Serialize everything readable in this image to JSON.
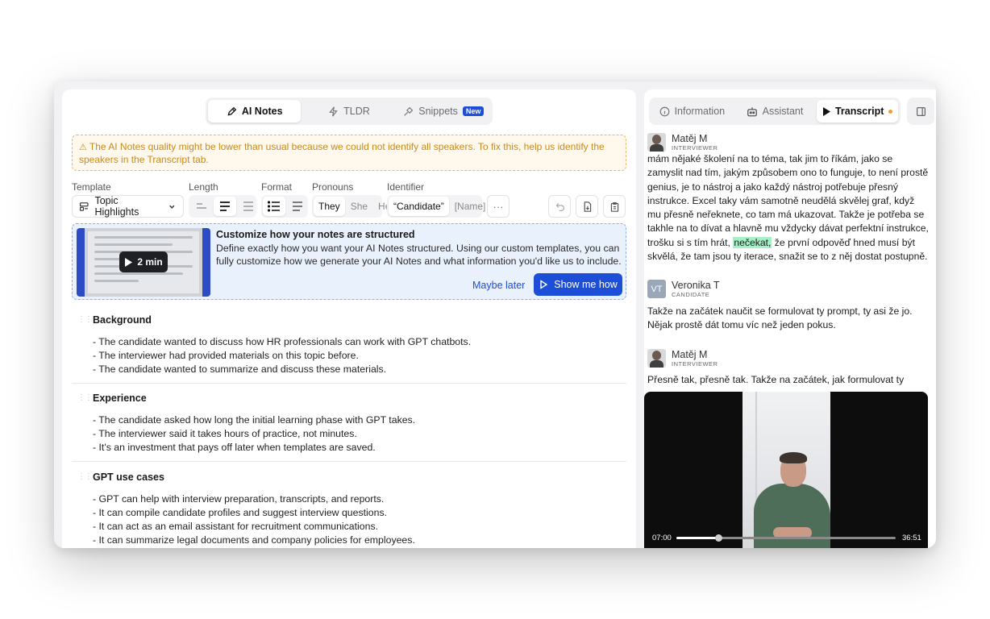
{
  "tabs": {
    "ai_notes": "AI Notes",
    "tldr": "TLDR",
    "snippets": "Snippets",
    "snippets_badge": "New"
  },
  "warning": "The AI Notes quality might be lower than usual because we could not identify all speakers. To fix this, help us identify the speakers in the Transcript tab.",
  "controls": {
    "template_label": "Template",
    "template_value": "Topic Highlights",
    "length_label": "Length",
    "format_label": "Format",
    "pronouns_label": "Pronouns",
    "pronouns": [
      "They",
      "She",
      "He"
    ],
    "identifier_label": "Identifier",
    "identifier_options": [
      "“Candidate”",
      "[Name]"
    ],
    "more": "···"
  },
  "promo": {
    "video_length": "2 min",
    "title": "Customize how your notes are structured",
    "description": "Define exactly how you want your AI Notes structured. Using our custom templates, you can fully customize how we generate your AI Notes and what information you'd like us to include.",
    "maybe_later": "Maybe later",
    "show_me_how": "Show me how"
  },
  "notes": [
    {
      "title": "Background",
      "bullets": [
        "- The candidate wanted to discuss how HR professionals can work with GPT chatbots.",
        "- The interviewer had provided materials on this topic before.",
        "- The candidate wanted to summarize and discuss these materials."
      ]
    },
    {
      "title": "Experience",
      "bullets": [
        "- The candidate asked how long the initial learning phase with GPT takes.",
        "- The interviewer said it takes hours of practice, not minutes.",
        "- It's an investment that pays off later when templates are saved."
      ]
    },
    {
      "title": "GPT use cases",
      "bullets": [
        "- GPT can help with interview preparation, transcripts, and reports.",
        "- It can compile candidate profiles and suggest interview questions.",
        "- It can act as an email assistant for recruitment communications.",
        "- It can summarize legal documents and company policies for employees."
      ]
    }
  ],
  "right_tabs": {
    "information": "Information",
    "assistant": "Assistant",
    "transcript": "Transcript"
  },
  "transcript": [
    {
      "name": "Matěj M",
      "role": "INTERVIEWER",
      "initials": "",
      "text_before": "mám nějaké školení na to téma, tak jim to říkám, jako se zamyslit nad tím, jakým způsobem ono to funguje, to není prostě genius, je to nástroj a jako každý nástroj potřebuje přesný instrukce. Excel taky vám samotně neudělá skvělej graf, když mu přesně neřeknete, co tam má ukazovat. Takže je potřeba se takhle na to dívat a hlavně mu vždycky dávat perfektní instrukce, trošku si s tím hrát,",
      "highlight": "nečekat,",
      "text_after": " že první odpověď hned musí být skvělá, že tam jsou ty iterace, snažit se to z něj dostat postupně."
    },
    {
      "name": "Veronika T",
      "role": "CANDIDATE",
      "initials": "VT",
      "text": "Takže na začátek naučit se formulovat ty prompt, ty asi že jo. Nějak prostě dát tomu víc než jeden pokus."
    },
    {
      "name": "Matěj M",
      "role": "INTERVIEWER",
      "initials": "",
      "text": "Přesně tak, přesně tak. Takže na začátek, jak formulovat ty"
    }
  ],
  "video": {
    "current_time": "07:00",
    "duration": "36:51",
    "progress": 0.19
  }
}
